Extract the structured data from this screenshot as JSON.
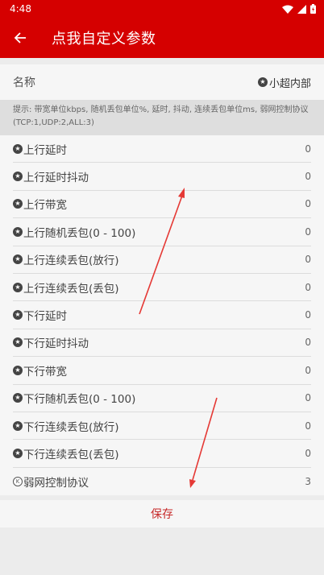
{
  "status_bar": {
    "time": "4:48"
  },
  "app_bar": {
    "title": "点我自定义参数"
  },
  "name_row": {
    "label": "名称",
    "value": "小超内部"
  },
  "hint": "提示: 带宽单位kbps, 随机丢包单位%, 延时, 抖动, 连续丢包单位ms, 弱网控制协议(TCP:1,UDP:2,ALL:3)",
  "items": [
    {
      "label": "上行延时",
      "value": "0"
    },
    {
      "label": "上行延时抖动",
      "value": "0"
    },
    {
      "label": "上行带宽",
      "value": "0"
    },
    {
      "label": "上行随机丢包(0 - 100)",
      "value": "0"
    },
    {
      "label": "上行连续丢包(放行)",
      "value": "0"
    },
    {
      "label": "上行连续丢包(丢包)",
      "value": "0"
    },
    {
      "label": "下行延时",
      "value": "0"
    },
    {
      "label": "下行延时抖动",
      "value": "0"
    },
    {
      "label": "下行带宽",
      "value": "0"
    },
    {
      "label": "下行随机丢包(0 - 100)",
      "value": "0"
    },
    {
      "label": "下行连续丢包(放行)",
      "value": "0"
    },
    {
      "label": "下行连续丢包(丢包)",
      "value": "0"
    },
    {
      "label": "弱网控制协议",
      "value": "3"
    }
  ],
  "save_label": "保存",
  "colors": {
    "primary": "#d50000",
    "save_text": "#c62828",
    "annotation": "#e53935"
  }
}
